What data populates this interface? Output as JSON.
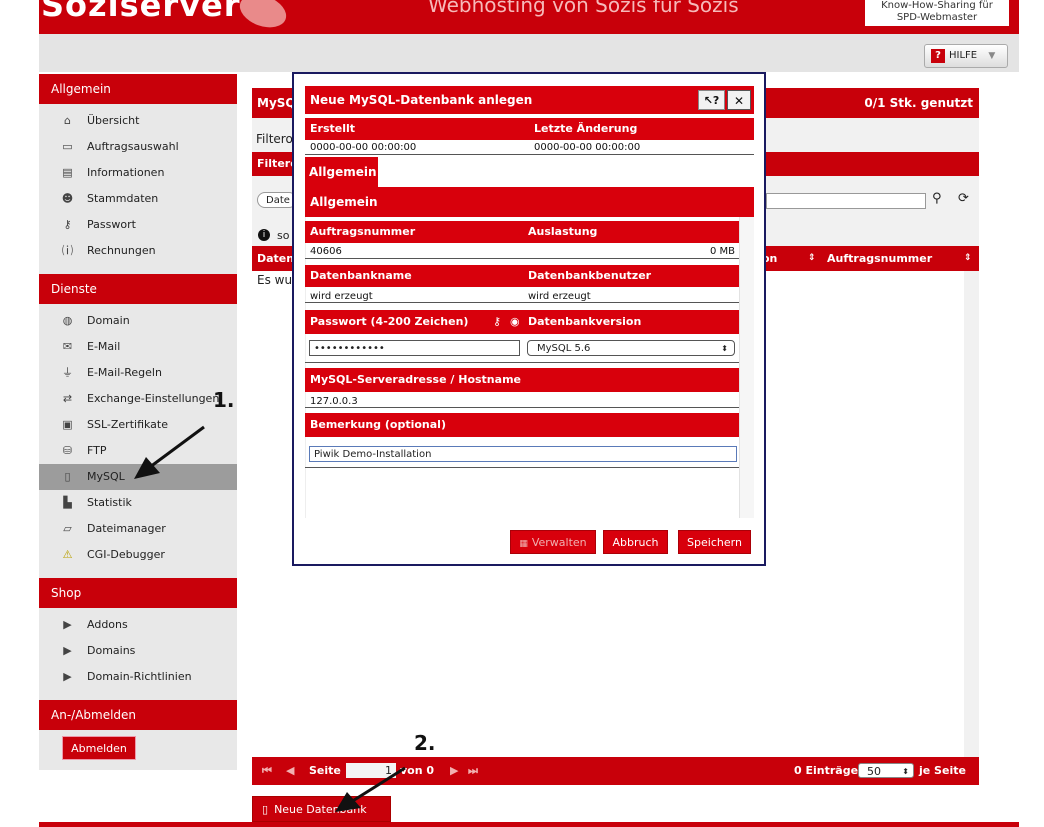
{
  "header": {
    "logo": "Soziserver",
    "tagline": "Webhosting von Sozis für Sozis",
    "knowhow_line1": "Know-How-Sharing für",
    "knowhow_line2": "SPD-Webmaster"
  },
  "help_button": "HILFE",
  "sidebar": {
    "sections": [
      {
        "title": "Allgemein",
        "items": [
          {
            "label": "Übersicht",
            "icon": "home-icon"
          },
          {
            "label": "Auftragsauswahl",
            "icon": "window-icon"
          },
          {
            "label": "Informationen",
            "icon": "document-icon"
          },
          {
            "label": "Stammdaten",
            "icon": "person-icon"
          },
          {
            "label": "Passwort",
            "icon": "key-icon"
          },
          {
            "label": "Rechnungen",
            "icon": "invoice-icon"
          }
        ]
      },
      {
        "title": "Dienste",
        "items": [
          {
            "label": "Domain",
            "icon": "globe-icon"
          },
          {
            "label": "E-Mail",
            "icon": "mail-icon"
          },
          {
            "label": "E-Mail-Regeln",
            "icon": "filter-icon"
          },
          {
            "label": "Exchange-Einstellungen",
            "icon": "sync-icon"
          },
          {
            "label": "SSL-Zertifikate",
            "icon": "lock-icon"
          },
          {
            "label": "FTP",
            "icon": "ftp-icon"
          },
          {
            "label": "MySQL",
            "icon": "database-icon"
          },
          {
            "label": "Statistik",
            "icon": "chart-icon"
          },
          {
            "label": "Dateimanager",
            "icon": "folder-icon"
          },
          {
            "label": "CGI-Debugger",
            "icon": "warning-icon"
          }
        ]
      },
      {
        "title": "Shop",
        "items": [
          {
            "label": "Addons",
            "icon": "arrow-right-icon"
          },
          {
            "label": "Domains",
            "icon": "arrow-right-icon"
          },
          {
            "label": "Domain-Richtlinien",
            "icon": "arrow-right-icon"
          }
        ]
      },
      {
        "title": "An-/Abmelden",
        "items": []
      }
    ],
    "logout_button": "Abmelden"
  },
  "main": {
    "title": "MySQL",
    "usage": "0/1 Stk. genutzt",
    "filter_label": "Filtero",
    "filter_red_label": "Filtero",
    "filter_select": "Date",
    "info_text": "so",
    "col_left": "Datenl",
    "col_mid": "on",
    "col_right": "Auftragsnummer",
    "empty_text": "Es wu",
    "pager_page": "Seite",
    "pager_page_value": "1",
    "pager_of": "von 0",
    "pager_entries": "0 Einträge,",
    "pager_per_page": "50",
    "pager_per_page_suffix": "je Seite",
    "new_db_button": "Neue Datenbank"
  },
  "dialog": {
    "title": "Neue MySQL-Datenbank anlegen",
    "help_icon_text": "?",
    "close_text": "✕",
    "created_label": "Erstellt",
    "created_value": "0000-00-00 00:00:00",
    "modified_label": "Letzte Änderung",
    "modified_value": "0000-00-00 00:00:00",
    "tab_general": "Allgemein",
    "section_general": "Allgemein",
    "order_label": "Auftragsnummer",
    "order_value": "40606",
    "load_label": "Auslastung",
    "load_value": "0 MB",
    "dbname_label": "Datenbankname",
    "dbname_value": "wird erzeugt",
    "dbuser_label": "Datenbankbenutzer",
    "dbuser_value": "wird erzeugt",
    "password_label": "Passwort (4-200 Zeichen)",
    "password_value": "••••••••••••",
    "dbversion_label": "Datenbankversion",
    "dbversion_value": "MySQL 5.6",
    "server_label": "MySQL-Serveradresse / Hostname",
    "server_value": "127.0.0.3",
    "remark_label": "Bemerkung (optional)",
    "remark_value": "Piwik Demo-Installation",
    "btn_manage": "Verwalten",
    "btn_cancel": "Abbruch",
    "btn_save": "Speichern"
  },
  "annotations": {
    "step1": "1.",
    "step2": "2."
  },
  "colors": {
    "brand_red": "#c8000a",
    "dialog_border": "#1a1a60"
  }
}
